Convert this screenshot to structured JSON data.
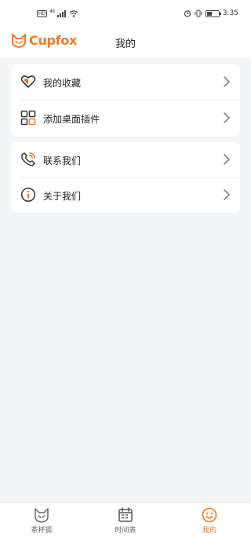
{
  "status_bar": {
    "network_badge": "HD",
    "signal_text": "⁴⁶",
    "time": "3:35"
  },
  "header": {
    "logo_text": "Cupfox",
    "title": "我的"
  },
  "menu": {
    "group1": [
      {
        "label": "我的收藏",
        "icon": "heart-icon"
      },
      {
        "label": "添加桌面插件",
        "icon": "widgets-icon"
      }
    ],
    "group2": [
      {
        "label": "联系我们",
        "icon": "phone-icon"
      },
      {
        "label": "关于我们",
        "icon": "info-icon"
      }
    ]
  },
  "tabbar": {
    "tabs": [
      {
        "label": "茶杯狐",
        "icon": "fox-icon",
        "active": false
      },
      {
        "label": "时间表",
        "icon": "calendar-icon",
        "active": false
      },
      {
        "label": "我的",
        "icon": "smiley-icon",
        "active": true
      }
    ]
  },
  "colors": {
    "accent": "#f07a2b",
    "background": "#f4f5f7",
    "card": "#ffffff"
  }
}
